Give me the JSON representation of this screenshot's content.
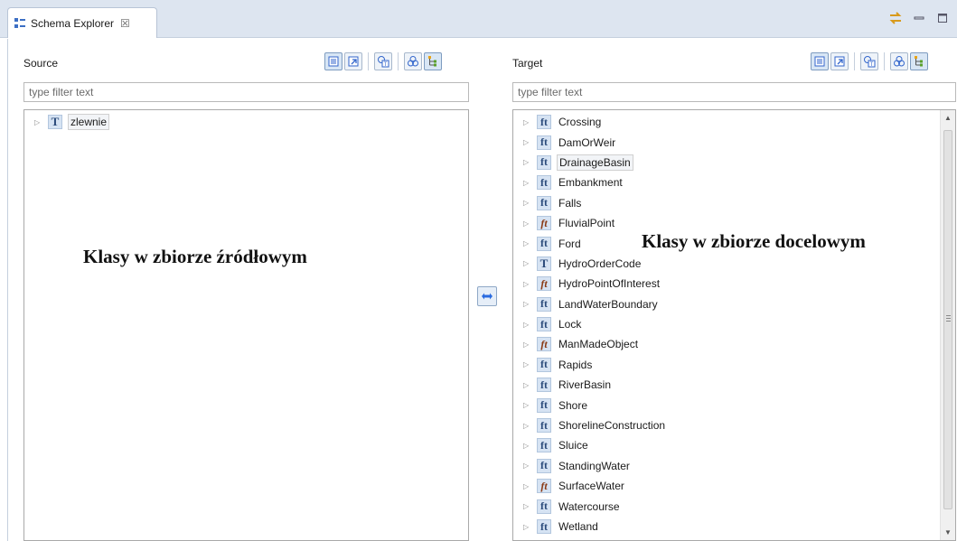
{
  "tab": {
    "title": "Schema Explorer",
    "close_glyph": "☒"
  },
  "source": {
    "title": "Source",
    "filter_placeholder": "type filter text",
    "items": [
      {
        "label": "zlewnie",
        "icon": "T"
      }
    ],
    "annotation": "Klasy w zbiorze źródłowym"
  },
  "target": {
    "title": "Target",
    "filter_placeholder": "type filter text",
    "items": [
      {
        "label": "Crossing",
        "icon": "ft"
      },
      {
        "label": "DamOrWeir",
        "icon": "ft"
      },
      {
        "label": "DrainageBasin",
        "icon": "ft"
      },
      {
        "label": "Embankment",
        "icon": "ft"
      },
      {
        "label": "Falls",
        "icon": "ft"
      },
      {
        "label": "FluvialPoint",
        "icon": "ft"
      },
      {
        "label": "Ford",
        "icon": "ft"
      },
      {
        "label": "HydroOrderCode",
        "icon": "T"
      },
      {
        "label": "HydroPointOfInterest",
        "icon": "ft"
      },
      {
        "label": "LandWaterBoundary",
        "icon": "ft"
      },
      {
        "label": "Lock",
        "icon": "ft"
      },
      {
        "label": "ManMadeObject",
        "icon": "ft"
      },
      {
        "label": "Rapids",
        "icon": "ft"
      },
      {
        "label": "RiverBasin",
        "icon": "ft"
      },
      {
        "label": "Shore",
        "icon": "ft"
      },
      {
        "label": "ShorelineConstruction",
        "icon": "ft"
      },
      {
        "label": "Sluice",
        "icon": "ft"
      },
      {
        "label": "StandingWater",
        "icon": "ft"
      },
      {
        "label": "SurfaceWater",
        "icon": "ft"
      },
      {
        "label": "Watercourse",
        "icon": "ft"
      },
      {
        "label": "Wetland",
        "icon": "ft"
      }
    ],
    "annotation": "Klasy w zbiorze docelowym"
  },
  "icons": {
    "twisty": "▷",
    "scroll_up": "▲",
    "scroll_down": "▼"
  },
  "colors": {
    "accent": "#3c6fc4",
    "abstract_type": "#8a3a14"
  }
}
